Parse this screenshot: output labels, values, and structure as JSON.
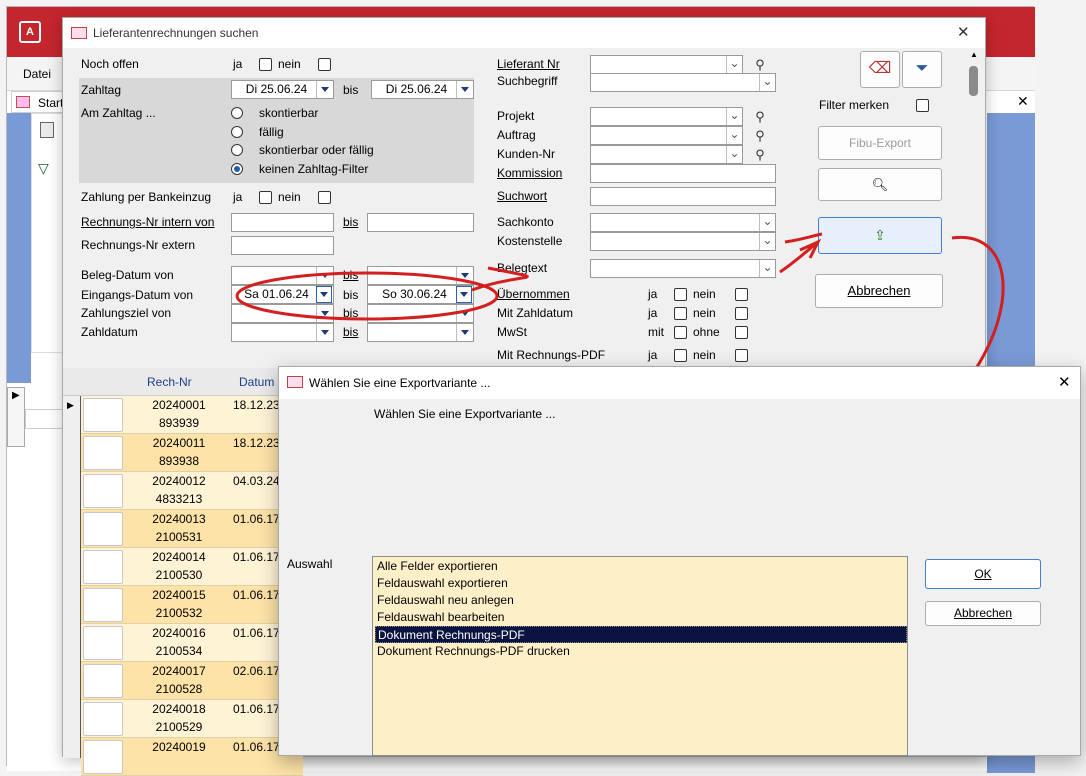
{
  "app": {
    "menu_file": "Datei",
    "start_tab": "Start"
  },
  "search": {
    "title": "Lieferantenrechnungen suchen",
    "noch_offen": "Noch offen",
    "ja": "ja",
    "nein": "nein",
    "bis": "bis",
    "mit": "mit",
    "ohne": "ohne",
    "zahltag": "Zahltag",
    "zahltag_von": "Di 25.06.24",
    "zahltag_bis": "Di 25.06.24",
    "am_zahltag": "Am Zahltag ...",
    "radio": [
      "skontierbar",
      "fällig",
      "skontierbar oder fällig",
      "keinen Zahltag-Filter"
    ],
    "bankeinzug": "Zahlung per Bankeinzug",
    "rn_intern": "Rechnungs-Nr intern von",
    "rn_extern": "Rechnungs-Nr extern",
    "beleg_datum": "Beleg-Datum von",
    "eingangs_datum": "Eingangs-Datum von",
    "eingangs_von": "Sa 01.06.24",
    "eingangs_bis": "So 30.06.24",
    "zahlungsziel": "Zahlungsziel von",
    "zahldatum": "Zahldatum",
    "lieferant_nr": "Lieferant Nr",
    "suchbegriff": "Suchbegriff",
    "projekt": "Projekt",
    "auftrag": "Auftrag",
    "kunden_nr": "Kunden-Nr",
    "kommission": "Kommission",
    "suchwort": "Suchwort",
    "sachkonto": "Sachkonto",
    "kostenstelle": "Kostenstelle",
    "belegtext": "Belegtext",
    "uebernommen": "Übernommen",
    "mit_zahldatum": "Mit Zahldatum",
    "mwst": "MwSt",
    "mit_pdf": "Mit Rechnungs-PDF",
    "filter_merken": "Filter merken",
    "fibu_export": "Fibu-Export",
    "abbrechen": "Abbrechen"
  },
  "grid": {
    "col_rech": "Rech-Nr",
    "col_datum": "Datum",
    "rows": [
      {
        "nr": "20240001",
        "ext": "893939",
        "datum": "18.12.23"
      },
      {
        "nr": "20240011",
        "ext": "893938",
        "datum": "18.12.23"
      },
      {
        "nr": "20240012",
        "ext": "4833213",
        "datum": "04.03.24"
      },
      {
        "nr": "20240013",
        "ext": "2100531",
        "datum": "01.06.17"
      },
      {
        "nr": "20240014",
        "ext": "2100530",
        "datum": "01.06.17"
      },
      {
        "nr": "20240015",
        "ext": "2100532",
        "datum": "01.06.17"
      },
      {
        "nr": "20240016",
        "ext": "2100534",
        "datum": "01.06.17"
      },
      {
        "nr": "20240017",
        "ext": "2100528",
        "datum": "02.06.17"
      },
      {
        "nr": "20240018",
        "ext": "2100529",
        "datum": "01.06.17"
      },
      {
        "nr": "20240019",
        "ext": "",
        "datum": "01.06.17"
      }
    ]
  },
  "export": {
    "title": "Wählen Sie eine Exportvariante ...",
    "prompt": "Wählen Sie eine Exportvariante  ...",
    "auswahl": "Auswahl",
    "options": [
      "Alle Felder exportieren",
      "Feldauswahl exportieren",
      "Feldauswahl neu anlegen",
      "Feldauswahl bearbeiten",
      "Dokument Rechnungs-PDF",
      "Dokument Rechnungs-PDF drucken"
    ],
    "selected_index": 4,
    "ok": "OK",
    "abbrechen": "Abbrechen"
  },
  "colors": {
    "accent_red": "#c4262e",
    "annotation_red": "#d41f1f",
    "list_bg": "#fdefc8",
    "selected_bg": "#0b1340"
  }
}
